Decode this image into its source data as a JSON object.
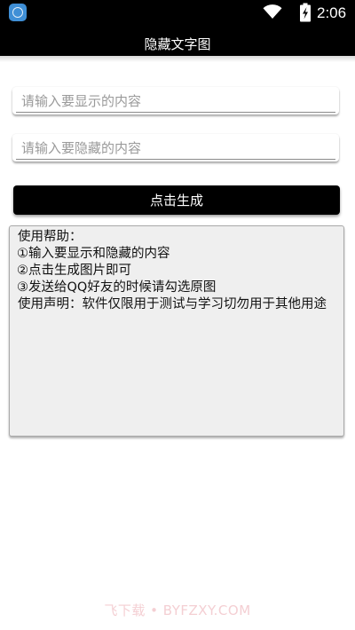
{
  "status_bar": {
    "time": "2:06",
    "app_icon": "qq-app-icon",
    "wifi_icon": "wifi-icon",
    "battery_icon": "battery-charging-icon"
  },
  "title_bar": {
    "title": "隐藏文字图"
  },
  "form": {
    "show_input_placeholder": "请输入要显示的内容",
    "hide_input_placeholder": "请输入要隐藏的内容",
    "show_input_value": "",
    "hide_input_value": "",
    "generate_label": "点击生成"
  },
  "help": {
    "lines": [
      "使用帮助：",
      "①输入要显示和隐藏的内容",
      "②点击生成图片即可",
      "③发送给QQ好友的时候请勾选原图",
      "使用声明：软件仅限用于测试与学习切勿用于其他用途"
    ]
  },
  "watermark": {
    "text": "飞下载 • BYFZXY.COM"
  },
  "colors": {
    "bar_background": "#000000",
    "help_background": "#efefef",
    "watermark": "#f4cfd3"
  }
}
